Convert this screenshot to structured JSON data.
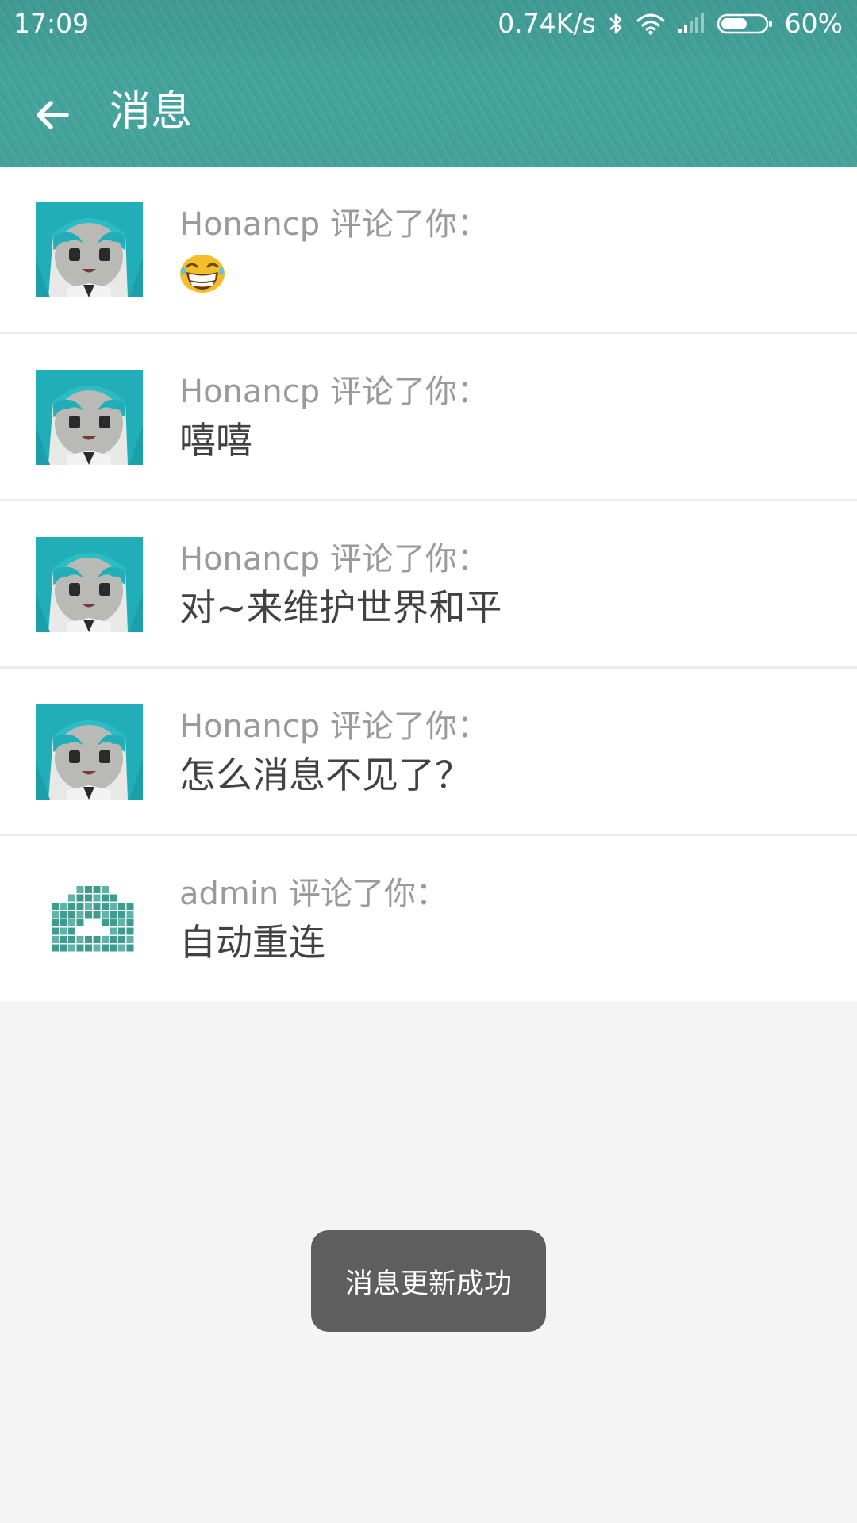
{
  "status_bar": {
    "time": "17:09",
    "network_speed": "0.74K/s",
    "battery_percent": "60%",
    "battery_level": 0.6,
    "icons": [
      "bluetooth-icon",
      "wifi-icon",
      "cell-signal-icon",
      "battery-icon"
    ]
  },
  "toolbar": {
    "back_icon": "arrow-left-icon",
    "title": "消息"
  },
  "messages": [
    {
      "sender_line": "Honancp 评论了你：",
      "body": "",
      "body_icon": "grinning-emoji-icon",
      "avatar": "anime-girl-avatar"
    },
    {
      "sender_line": "Honancp 评论了你：",
      "body": "嘻嘻",
      "avatar": "anime-girl-avatar"
    },
    {
      "sender_line": "Honancp 评论了你：",
      "body": "对~来维护世界和平",
      "avatar": "anime-girl-avatar"
    },
    {
      "sender_line": "Honancp 评论了你：",
      "body": "怎么消息不见了？",
      "avatar": "anime-girl-avatar"
    },
    {
      "sender_line": "admin 评论了你：",
      "body": "自动重连",
      "avatar": "pixel-identicon-avatar"
    }
  ],
  "toast": {
    "text": "消息更新成功"
  },
  "colors": {
    "header": "#45a39b",
    "background": "#f4f4f4",
    "toast_bg": "#5e5e5e",
    "sender_text": "#9a9a9a",
    "body_text": "#424242"
  }
}
